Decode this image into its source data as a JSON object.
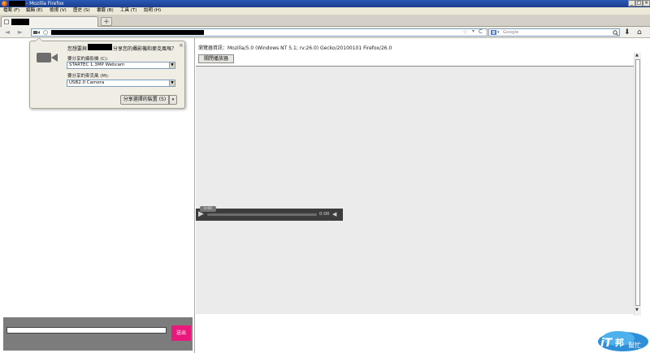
{
  "window": {
    "title": "- Mozilla Firefox",
    "min": "_",
    "max": "□",
    "close": "×"
  },
  "menu": [
    "檔案 (F)",
    "編輯 (E)",
    "檢視 (V)",
    "歷史 (S)",
    "書籤 (B)",
    "工具 (T)",
    "說明 (H)"
  ],
  "tabs": {
    "new_tab": "+"
  },
  "nav": {
    "back": "◄",
    "forward": "►",
    "search_engine_letter": "g",
    "search_dropdown": "▾",
    "search_placeholder": "Google",
    "search_icon": "magnifier-icon",
    "star": "☆",
    "url_dropdown": "▾",
    "reload": "C",
    "download": "⬇",
    "home": "⌂"
  },
  "popup": {
    "question_before": "您想要與",
    "question_after": "分享您的攝影機和麥克風嗎？",
    "camera_label": "要分享的攝影機 (C):",
    "camera_value": "STARTEC 1.3MP Webcam",
    "mic_label": "要分享的麥克風 (M):",
    "mic_value": "USB2.0 Camera",
    "share_button": "分享選擇的裝置 (S)",
    "share_dropdown": "▾",
    "close": "×",
    "select_arrow": "▼"
  },
  "page": {
    "browser_info": "瀏覽器資訊：Mozilla/5.0 (Windows NT 5.1; rv:26.0) Gecko/20100101 Firefox/26.0",
    "stop_button": "關閉播放器",
    "player": {
      "time": "0:00",
      "play": "▶",
      "volume": "◀",
      "tooltip": "0:00"
    },
    "scroll_up": "▲",
    "scroll_down": "▼"
  },
  "chat": {
    "send": "送出",
    "input_value": ""
  },
  "watermark": {
    "it": "iT",
    "bang": "邦",
    "help": "幫忙"
  },
  "colors": {
    "titlebar": "#1b3d8c",
    "send": "#e8187d",
    "chatbox": "#7c7c7c"
  }
}
